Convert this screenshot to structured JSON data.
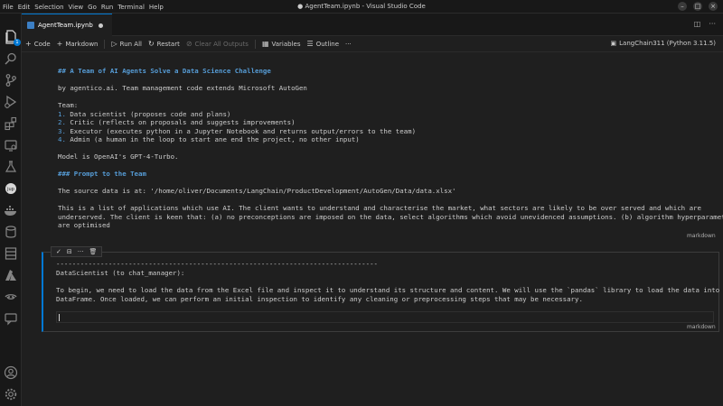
{
  "window": {
    "title": "● AgentTeam.ipynb - Visual Studio Code",
    "menu": [
      "File",
      "Edit",
      "Selection",
      "View",
      "Go",
      "Run",
      "Terminal",
      "Help"
    ],
    "controls": [
      "–",
      "□",
      "×"
    ]
  },
  "activity": {
    "badge": "1"
  },
  "tab": {
    "label": "AgentTeam.ipynb"
  },
  "toolbar": {
    "code": "Code",
    "markdown": "Markdown",
    "run_all": "Run All",
    "restart": "Restart",
    "clear_all": "Clear All Outputs",
    "variables": "Variables",
    "outline": "Outline",
    "more": "···",
    "kernel": "LangChain311 (Python 3.11.5)"
  },
  "cell1": {
    "heading": "## A Team of AI Agents Solve a Data Science Challenge",
    "byline": "by agentico.ai. Team management code extends Microsoft AutoGen",
    "team_label": "Team:",
    "team": [
      {
        "n": "1.",
        "text": " Data scientist (proposes code and plans)"
      },
      {
        "n": "2.",
        "text": " Critic (reflects on proposals and suggests improvements)"
      },
      {
        "n": "3.",
        "text": " Executor (executes python in a Jupyter Notebook and returns output/errors to the team)"
      },
      {
        "n": "4.",
        "text": " Admin (a human in the loop to start ane end the project, no other input)"
      }
    ],
    "model": "Model is OpenAI's GPT-4-Turbo.",
    "prompt_heading": "### Prompt to the Team",
    "source": "The source data is at: '/home/oliver/Documents/LangChain/ProductDevelopment/AutoGen/Data/data.xlsx'",
    "para_lines": [
      "This is a list of applications which use AI. The client wants to understand and characterise the market, what sectors are likely to be over served and which are",
      "underserved. The client is keen that: (a) no preconceptions are imposed on the data, select algorithms which avoid unevidenced assumptions. (b) algorithm hyperparameters",
      "are optimised"
    ],
    "tag": "markdown"
  },
  "cell2": {
    "dashes": "--------------------------------------------------------------------------------",
    "speaker": "DataScientist (to chat_manager):",
    "lines": [
      "To begin, we need to load the data from the Excel file and inspect it to understand its structure and content. We will use the `pandas` library to load the data into a",
      "DataFrame. Once loaded, we can perform an initial inspection to identify any cleaning or preprocessing steps that may be necessary."
    ],
    "tag": "markdown",
    "tools": [
      "✓",
      "⊟",
      "···",
      "🗑"
    ]
  }
}
